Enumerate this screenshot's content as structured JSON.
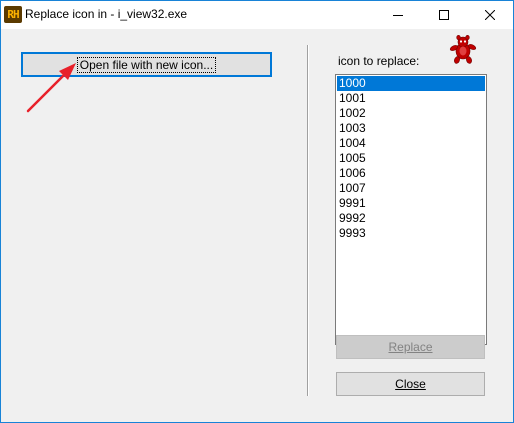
{
  "window": {
    "app_icon_text": "RH",
    "title": "Replace icon in - i_view32.exe",
    "controls": {
      "minimize": "minimize-icon",
      "maximize": "maximize-icon",
      "close": "close-icon"
    }
  },
  "left_panel": {
    "open_button_label": "Open file with new icon..."
  },
  "right_panel": {
    "list_label": "icon to replace:",
    "icons": [
      "1000",
      "1001",
      "1002",
      "1003",
      "1004",
      "1005",
      "1006",
      "1007",
      "9991",
      "9992",
      "9993"
    ],
    "selected": "1000",
    "replace_label": "Replace",
    "replace_enabled": false,
    "close_label": "Close"
  },
  "colors": {
    "accent": "#0078d7",
    "selection": "#0078d7",
    "arrow": "#e8212a",
    "mascot": "#c00000"
  }
}
